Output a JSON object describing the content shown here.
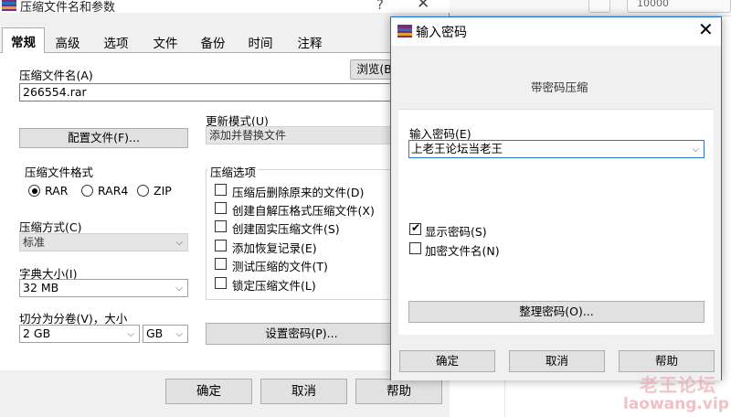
{
  "background": {
    "top_right_text": "10000"
  },
  "main_dialog": {
    "title": "压缩文件名和参数",
    "help_symbol": "?",
    "close_symbol": "✕",
    "tabs": [
      {
        "label": "常规"
      },
      {
        "label": "高级"
      },
      {
        "label": "选项"
      },
      {
        "label": "文件"
      },
      {
        "label": "备份"
      },
      {
        "label": "时间"
      },
      {
        "label": "注释"
      }
    ],
    "archive_name_label": "压缩文件名(A)",
    "archive_name_value": "266554.rar",
    "browse_button": "浏览(B)...",
    "profiles_button": "配置文件(F)...",
    "update_mode_label": "更新模式(U)",
    "update_mode_value": "添加并替换文件",
    "format_group_title": "压缩文件格式",
    "formats": [
      {
        "label": "RAR",
        "selected": true
      },
      {
        "label": "RAR4",
        "selected": false
      },
      {
        "label": "ZIP",
        "selected": false
      }
    ],
    "options_group_title": "压缩选项",
    "options": [
      {
        "label": "压缩后删除原来的文件(D)",
        "checked": false
      },
      {
        "label": "创建自解压格式压缩文件(X)",
        "checked": false
      },
      {
        "label": "创建固实压缩文件(S)",
        "checked": false
      },
      {
        "label": "添加恢复记录(E)",
        "checked": false
      },
      {
        "label": "测试压缩的文件(T)",
        "checked": false
      },
      {
        "label": "锁定压缩文件(L)",
        "checked": false
      }
    ],
    "method_label": "压缩方式(C)",
    "method_value": "标准",
    "dict_label": "字典大小(I)",
    "dict_value": "32 MB",
    "split_label": "切分为分卷(V)，大小",
    "split_value": "2 GB",
    "split_unit": "GB",
    "set_password_button": "设置密码(P)...",
    "ok_button": "确定",
    "cancel_button": "取消",
    "help_button": "帮助"
  },
  "password_dialog": {
    "title": "输入密码",
    "close_symbol": "✕",
    "subtitle": "带密码压缩",
    "enter_label": "输入密码(E)",
    "password_value": "上老王论坛当老王",
    "show_password_label": "显示密码(S)",
    "show_password_checked": true,
    "encrypt_names_label": "加密文件名(N)",
    "encrypt_names_checked": false,
    "organize_button": "整理密码(O)...",
    "ok_button": "确定",
    "cancel_button": "取消",
    "help_button": "帮助"
  },
  "watermark": {
    "name": "老王论坛",
    "url": "laowang.vip"
  }
}
